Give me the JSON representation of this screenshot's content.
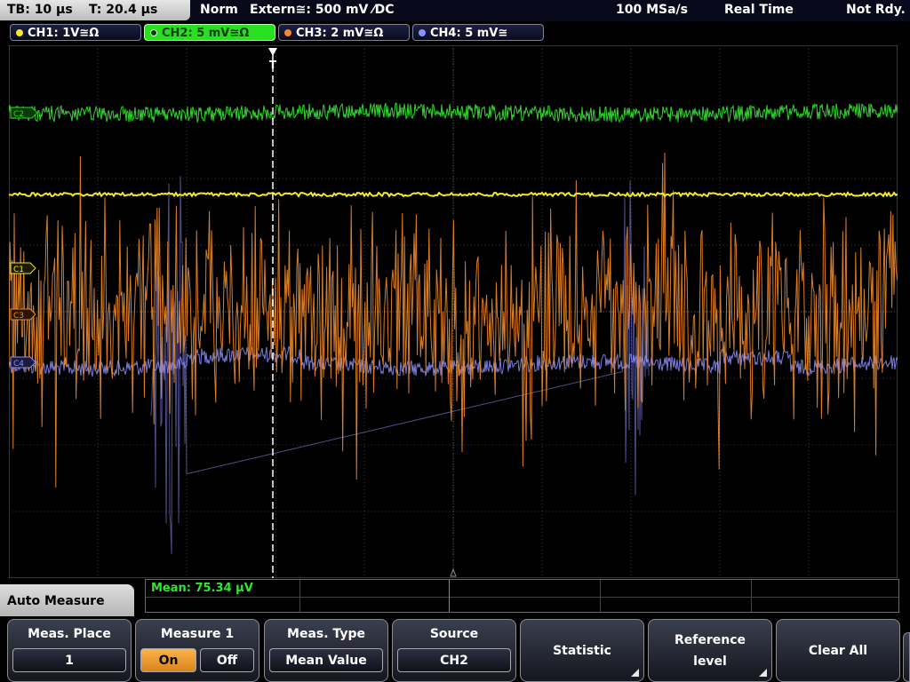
{
  "status": {
    "timebase": "TB: 10 µs",
    "trigger_time": "T: 20.4 µs",
    "trigger_mode": "Norm",
    "trigger_source": "Extern≅: 500 mV ⁄DC",
    "sample_rate": "100 MSa/s",
    "acq_mode": "Real Time",
    "trigger_state": "Not Rdy."
  },
  "channels": [
    {
      "label": "CH1: 1V≅Ω",
      "color": "#f2ea22",
      "active": false
    },
    {
      "label": "CH2: 5 mV≅Ω",
      "color": "#2ed62a",
      "active": true
    },
    {
      "label": "CH3: 2 mV≅Ω",
      "color": "#f08a2a",
      "active": false
    },
    {
      "label": "CH4: 5 mV≅",
      "color": "#8f90ff",
      "active": false
    }
  ],
  "markers": {
    "c1": "C1",
    "c2": "C2",
    "c3": "C3",
    "c4": "C4",
    "trigger": "T"
  },
  "measurement": {
    "mean_text": "Mean: 75.34 µV"
  },
  "auto_measure": {
    "title": "Auto Measure"
  },
  "softkeys": {
    "meas_place": {
      "title": "Meas. Place",
      "value": "1"
    },
    "measure1": {
      "title": "Measure 1",
      "on": "On",
      "off": "Off",
      "selected": "On"
    },
    "meas_type": {
      "title": "Meas. Type",
      "value": "Mean Value"
    },
    "source": {
      "title": "Source",
      "value": "CH2"
    },
    "statistic": {
      "title": "Statistic"
    },
    "reference_level": {
      "title": "Reference level"
    },
    "clear_all": {
      "title": "Clear All"
    }
  }
}
